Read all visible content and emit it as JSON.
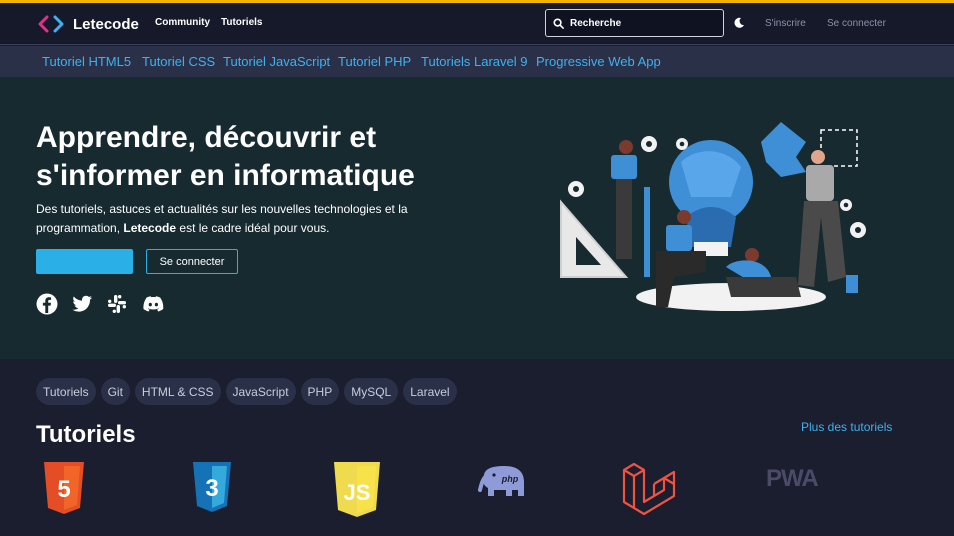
{
  "brand": {
    "name": "Letecode",
    "accent": "#f5b301",
    "link": "#3fb1f0"
  },
  "nav": {
    "links": [
      "Community",
      "Tutoriels"
    ],
    "search_placeholder": "Recherche",
    "signup": "S'inscrire",
    "login": "Se connecter"
  },
  "subnav": [
    "Tutoriel HTML5",
    "Tutoriel CSS",
    "Tutoriel JavaScript",
    "Tutoriel PHP",
    "Tutoriels Laravel 9",
    "Progressive Web App"
  ],
  "hero": {
    "title": "Apprendre, découvrir et s'informer en informatique",
    "desc_before": "Des tutoriels, astuces et actualités sur les nouvelles technologies et la programmation, ",
    "desc_brand": "Letecode",
    "desc_after": " est le cadre idéal pour vous.",
    "primary_button": "",
    "secondary_button": "Se connecter",
    "socials": [
      "facebook-icon",
      "twitter-icon",
      "slack-icon",
      "discord-icon"
    ]
  },
  "tags": [
    "Tutoriels",
    "Git",
    "HTML & CSS",
    "JavaScript",
    "PHP",
    "MySQL",
    "Laravel"
  ],
  "tutorials": {
    "title": "Tutoriels",
    "more": "Plus des tutoriels",
    "logos": [
      {
        "icon": "html5-logo-icon",
        "text": "5"
      },
      {
        "icon": "css3-logo-icon",
        "text": "3"
      },
      {
        "icon": "javascript-logo-icon",
        "text": "JS"
      },
      {
        "icon": "php-elephant-icon",
        "text": "php"
      },
      {
        "icon": "laravel-logo-icon",
        "text": ""
      },
      {
        "icon": "pwa-logo-icon",
        "text": "PWA"
      }
    ]
  }
}
